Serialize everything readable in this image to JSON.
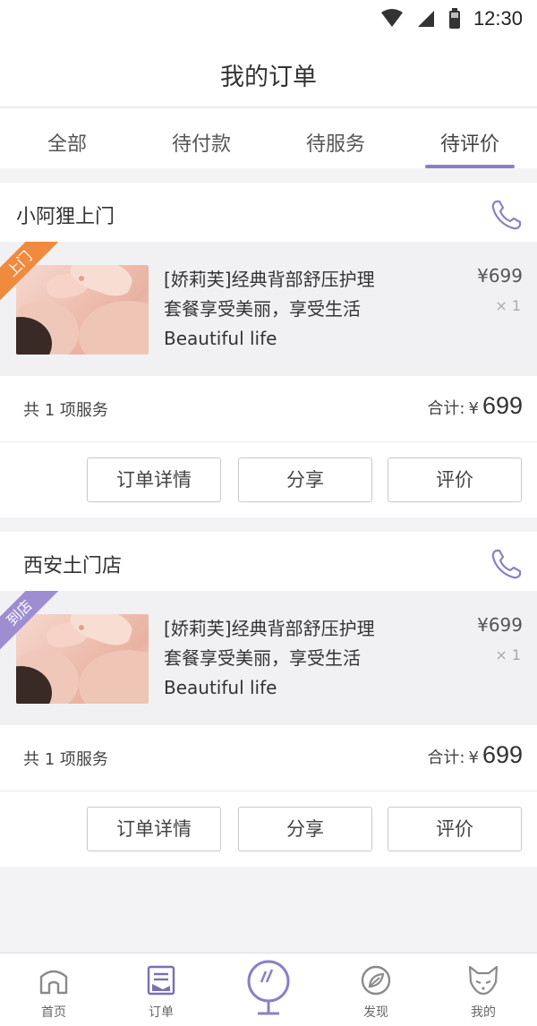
{
  "status_bar": {
    "time": "12:30"
  },
  "header": {
    "title": "我的订单"
  },
  "tabs": [
    {
      "label": "全部"
    },
    {
      "label": "待付款"
    },
    {
      "label": "待服务"
    },
    {
      "label": "待评价",
      "active": true
    }
  ],
  "orders": [
    {
      "shop_name": "小阿狸上门",
      "ribbon": "上门",
      "ribbon_color": "#f08a3e",
      "item_title": "[娇莉芙]经典背部舒压护理",
      "item_line2": "套餐享受美丽，享受生活",
      "item_line3": "Beautiful life",
      "price": "¥699",
      "qty": "× 1",
      "count_text": "共 1 项服务",
      "total_label": "合计:",
      "total_currency": "¥",
      "total_amount": "699",
      "buttons": {
        "detail": "订单详情",
        "share": "分享",
        "review": "评价"
      }
    },
    {
      "shop_name": "西安土门店",
      "ribbon": "到店",
      "ribbon_color": "#9d8ed2",
      "item_title": "[娇莉芙]经典背部舒压护理",
      "item_line2": "套餐享受美丽，享受生活",
      "item_line3": "Beautiful life",
      "price": "¥699",
      "qty": "× 1",
      "count_text": "共 1 项服务",
      "total_label": "合计:",
      "total_currency": "¥",
      "total_amount": "699",
      "buttons": {
        "detail": "订单详情",
        "share": "分享",
        "review": "评价"
      }
    }
  ],
  "bottom_nav": [
    {
      "label": "首页",
      "icon": "home-icon"
    },
    {
      "label": "订单",
      "icon": "order-icon"
    },
    {
      "label": "",
      "icon": "mirror-icon"
    },
    {
      "label": "发现",
      "icon": "discover-icon"
    },
    {
      "label": "我的",
      "icon": "fox-profile-icon"
    }
  ],
  "colors": {
    "accent": "#8b7fc6",
    "ribbon_orange": "#f08a3e",
    "ribbon_purple": "#9d8ed2"
  }
}
